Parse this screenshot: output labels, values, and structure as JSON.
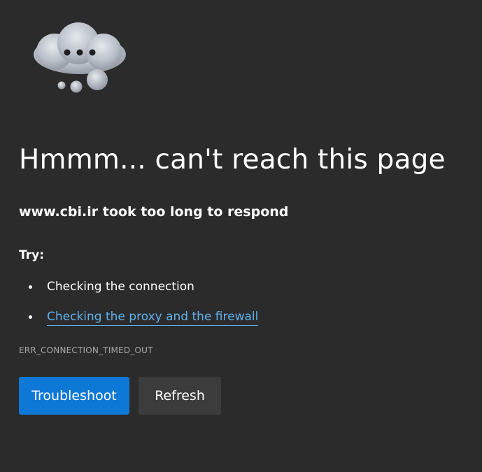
{
  "illustration": {
    "icon": "cloud-thinking-icon"
  },
  "error": {
    "title": "Hmmm... can't reach this page",
    "subtitle": "www.cbi.ir took too long to respond",
    "try_label": "Try:",
    "suggestions": [
      {
        "text": "Checking the connection",
        "is_link": false
      },
      {
        "text": "Checking the proxy and the firewall",
        "is_link": true
      }
    ],
    "code": "ERR_CONNECTION_TIMED_OUT"
  },
  "buttons": {
    "troubleshoot": "Troubleshoot",
    "refresh": "Refresh"
  },
  "colors": {
    "background": "#2b2b2b",
    "primary_button": "#0e78d7",
    "secondary_button": "#3c3c3c",
    "link": "#5fb2ee",
    "error_code": "#a8a8a8"
  }
}
